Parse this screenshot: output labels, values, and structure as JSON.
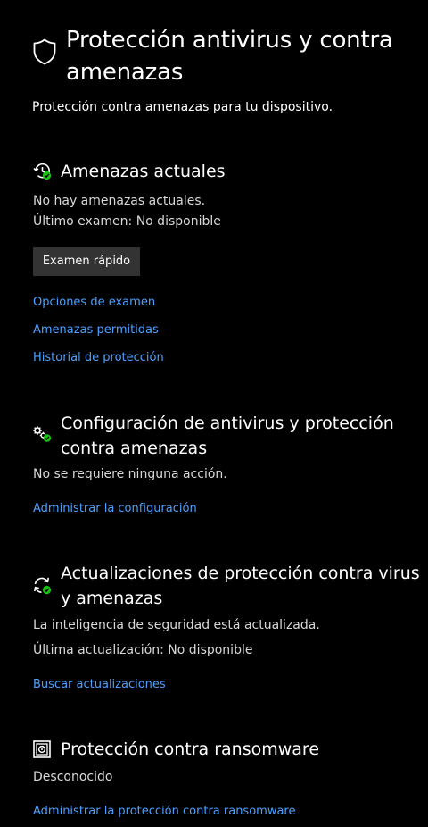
{
  "header": {
    "title": "Protección antivirus y contra amenazas",
    "subtitle": "Protección contra amenazas para tu dispositivo.",
    "icon": "shield-icon"
  },
  "current_threats": {
    "icon": "history-check-icon",
    "title": "Amenazas actuales",
    "status": "No hay amenazas actuales.",
    "last_scan": "Último examen: No disponible",
    "quick_scan_label": "Examen rápido",
    "links": {
      "scan_options": "Opciones de examen",
      "allowed_threats": "Amenazas permitidas",
      "protection_history": "Historial de protección"
    }
  },
  "settings": {
    "icon": "gears-check-icon",
    "title": "Configuración de antivirus y protección contra amenazas",
    "status": "No se requiere ninguna acción.",
    "manage_link": "Administrar la configuración"
  },
  "updates": {
    "icon": "refresh-check-icon",
    "title": "Actualizaciones de protección contra virus y amenazas",
    "status": "La inteligencia de seguridad está actualizada.",
    "last_update": "Última actualización: No disponible",
    "check_link": "Buscar actualizaciones"
  },
  "ransomware": {
    "icon": "ransomware-icon",
    "title": "Protección contra ransomware",
    "status": "Desconocido",
    "manage_link": "Administrar la protección contra ransomware"
  },
  "colors": {
    "background": "#000000",
    "text": "#ffffff",
    "secondary_text": "#d8d8d8",
    "link": "#4ca0ff",
    "button": "#333333",
    "success": "#16c60c"
  }
}
